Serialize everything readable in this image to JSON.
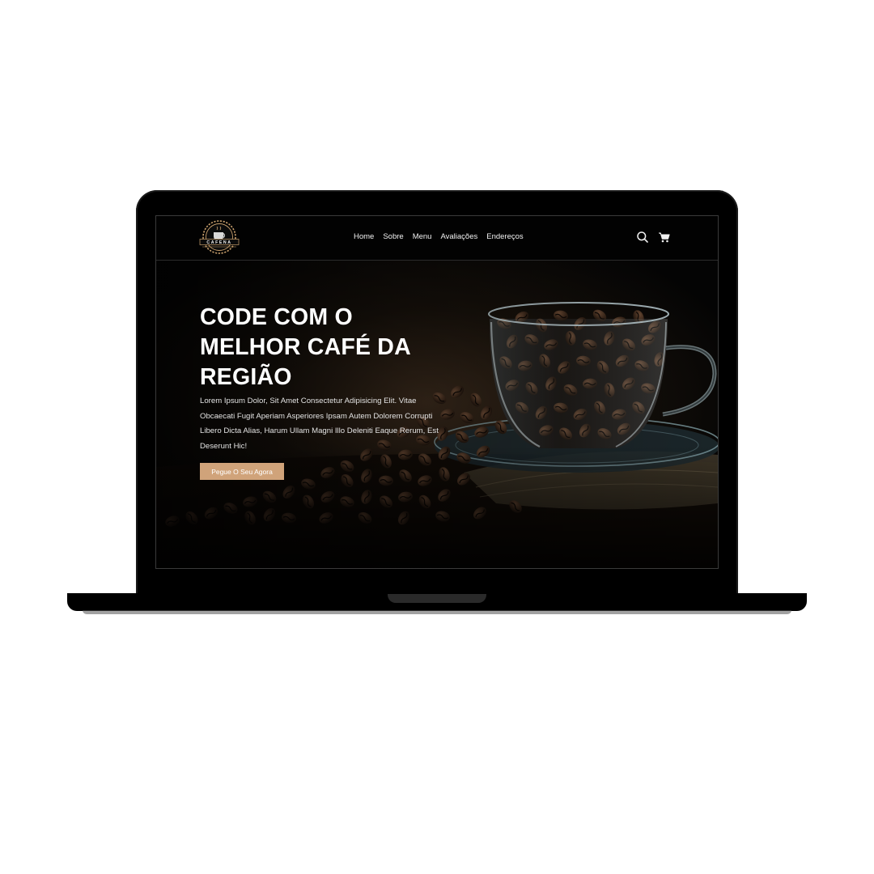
{
  "brand": {
    "logo_text": "CAFENA"
  },
  "nav": {
    "items": [
      {
        "label": "Home"
      },
      {
        "label": "Sobre"
      },
      {
        "label": "Menu"
      },
      {
        "label": "Avaliações"
      },
      {
        "label": "Endereços"
      }
    ],
    "icons": [
      "search-icon",
      "cart-icon"
    ]
  },
  "hero": {
    "title": "CODE COM O MELHOR CAFÉ DA REGIÃO",
    "description": "Lorem Ipsum Dolor, Sit Amet Consectetur Adipisicing Elit. Vitae Obcaecati Fugit Aperiam Asperiores Ipsam Autem Dolorem Corrupti Libero Dicta Alias, Harum Ullam Magni Illo Deleniti Eaque Rerum, Est Deserunt Hic!",
    "cta_label": "Pegue O Seu Agora"
  },
  "colors": {
    "accent": "#d0a37a",
    "background": "#050505",
    "text": "#ffffff"
  }
}
